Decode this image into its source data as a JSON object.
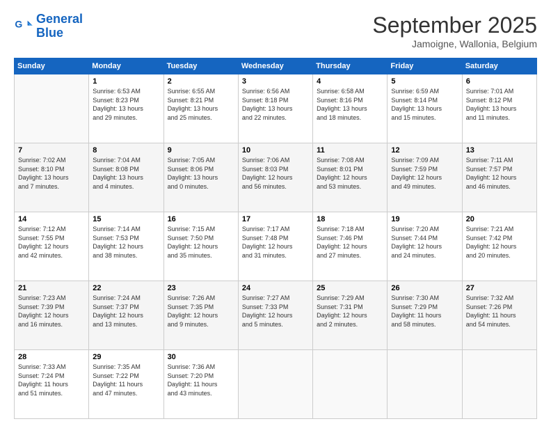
{
  "header": {
    "logo_line1": "General",
    "logo_line2": "Blue",
    "month": "September 2025",
    "location": "Jamoigne, Wallonia, Belgium"
  },
  "weekdays": [
    "Sunday",
    "Monday",
    "Tuesday",
    "Wednesday",
    "Thursday",
    "Friday",
    "Saturday"
  ],
  "weeks": [
    [
      {
        "day": "",
        "info": ""
      },
      {
        "day": "1",
        "info": "Sunrise: 6:53 AM\nSunset: 8:23 PM\nDaylight: 13 hours\nand 29 minutes."
      },
      {
        "day": "2",
        "info": "Sunrise: 6:55 AM\nSunset: 8:21 PM\nDaylight: 13 hours\nand 25 minutes."
      },
      {
        "day": "3",
        "info": "Sunrise: 6:56 AM\nSunset: 8:18 PM\nDaylight: 13 hours\nand 22 minutes."
      },
      {
        "day": "4",
        "info": "Sunrise: 6:58 AM\nSunset: 8:16 PM\nDaylight: 13 hours\nand 18 minutes."
      },
      {
        "day": "5",
        "info": "Sunrise: 6:59 AM\nSunset: 8:14 PM\nDaylight: 13 hours\nand 15 minutes."
      },
      {
        "day": "6",
        "info": "Sunrise: 7:01 AM\nSunset: 8:12 PM\nDaylight: 13 hours\nand 11 minutes."
      }
    ],
    [
      {
        "day": "7",
        "info": "Sunrise: 7:02 AM\nSunset: 8:10 PM\nDaylight: 13 hours\nand 7 minutes."
      },
      {
        "day": "8",
        "info": "Sunrise: 7:04 AM\nSunset: 8:08 PM\nDaylight: 13 hours\nand 4 minutes."
      },
      {
        "day": "9",
        "info": "Sunrise: 7:05 AM\nSunset: 8:06 PM\nDaylight: 13 hours\nand 0 minutes."
      },
      {
        "day": "10",
        "info": "Sunrise: 7:06 AM\nSunset: 8:03 PM\nDaylight: 12 hours\nand 56 minutes."
      },
      {
        "day": "11",
        "info": "Sunrise: 7:08 AM\nSunset: 8:01 PM\nDaylight: 12 hours\nand 53 minutes."
      },
      {
        "day": "12",
        "info": "Sunrise: 7:09 AM\nSunset: 7:59 PM\nDaylight: 12 hours\nand 49 minutes."
      },
      {
        "day": "13",
        "info": "Sunrise: 7:11 AM\nSunset: 7:57 PM\nDaylight: 12 hours\nand 46 minutes."
      }
    ],
    [
      {
        "day": "14",
        "info": "Sunrise: 7:12 AM\nSunset: 7:55 PM\nDaylight: 12 hours\nand 42 minutes."
      },
      {
        "day": "15",
        "info": "Sunrise: 7:14 AM\nSunset: 7:53 PM\nDaylight: 12 hours\nand 38 minutes."
      },
      {
        "day": "16",
        "info": "Sunrise: 7:15 AM\nSunset: 7:50 PM\nDaylight: 12 hours\nand 35 minutes."
      },
      {
        "day": "17",
        "info": "Sunrise: 7:17 AM\nSunset: 7:48 PM\nDaylight: 12 hours\nand 31 minutes."
      },
      {
        "day": "18",
        "info": "Sunrise: 7:18 AM\nSunset: 7:46 PM\nDaylight: 12 hours\nand 27 minutes."
      },
      {
        "day": "19",
        "info": "Sunrise: 7:20 AM\nSunset: 7:44 PM\nDaylight: 12 hours\nand 24 minutes."
      },
      {
        "day": "20",
        "info": "Sunrise: 7:21 AM\nSunset: 7:42 PM\nDaylight: 12 hours\nand 20 minutes."
      }
    ],
    [
      {
        "day": "21",
        "info": "Sunrise: 7:23 AM\nSunset: 7:39 PM\nDaylight: 12 hours\nand 16 minutes."
      },
      {
        "day": "22",
        "info": "Sunrise: 7:24 AM\nSunset: 7:37 PM\nDaylight: 12 hours\nand 13 minutes."
      },
      {
        "day": "23",
        "info": "Sunrise: 7:26 AM\nSunset: 7:35 PM\nDaylight: 12 hours\nand 9 minutes."
      },
      {
        "day": "24",
        "info": "Sunrise: 7:27 AM\nSunset: 7:33 PM\nDaylight: 12 hours\nand 5 minutes."
      },
      {
        "day": "25",
        "info": "Sunrise: 7:29 AM\nSunset: 7:31 PM\nDaylight: 12 hours\nand 2 minutes."
      },
      {
        "day": "26",
        "info": "Sunrise: 7:30 AM\nSunset: 7:29 PM\nDaylight: 11 hours\nand 58 minutes."
      },
      {
        "day": "27",
        "info": "Sunrise: 7:32 AM\nSunset: 7:26 PM\nDaylight: 11 hours\nand 54 minutes."
      }
    ],
    [
      {
        "day": "28",
        "info": "Sunrise: 7:33 AM\nSunset: 7:24 PM\nDaylight: 11 hours\nand 51 minutes."
      },
      {
        "day": "29",
        "info": "Sunrise: 7:35 AM\nSunset: 7:22 PM\nDaylight: 11 hours\nand 47 minutes."
      },
      {
        "day": "30",
        "info": "Sunrise: 7:36 AM\nSunset: 7:20 PM\nDaylight: 11 hours\nand 43 minutes."
      },
      {
        "day": "",
        "info": ""
      },
      {
        "day": "",
        "info": ""
      },
      {
        "day": "",
        "info": ""
      },
      {
        "day": "",
        "info": ""
      }
    ]
  ]
}
